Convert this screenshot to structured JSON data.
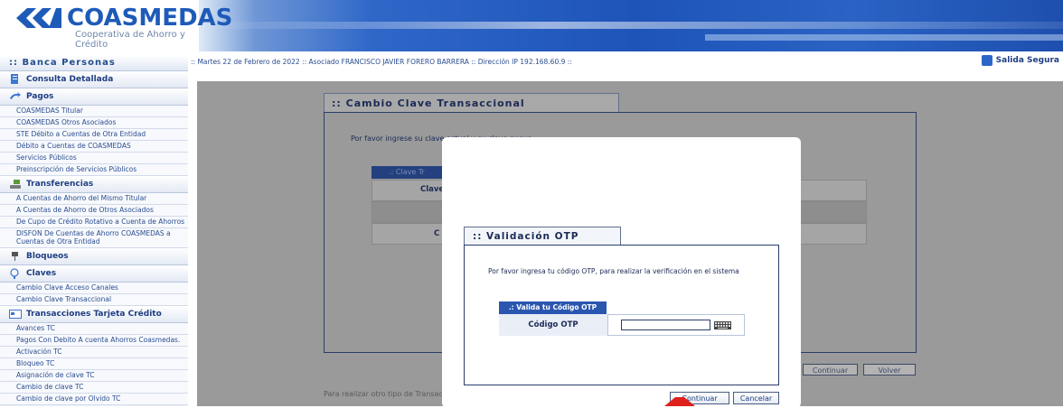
{
  "brand": {
    "name": "COASMEDAS",
    "tagline": "Cooperativa de Ahorro y Crédito",
    "primary_color": "#1e5bb8"
  },
  "sidebar": {
    "title": ":: Banca Personas",
    "sections": [
      {
        "label": "Consulta Detallada",
        "icon": "document-icon",
        "items": []
      },
      {
        "label": "Pagos",
        "icon": "transfer-arrows-icon",
        "items": [
          "COASMEDAS Titular",
          "COASMEDAS Otros Asociados",
          "STE Débito a Cuentas de Otra Entidad",
          "Débito a Cuentas de COASMEDAS",
          "Servicios Públicos",
          "Preinscripción de Servicios Públicos"
        ]
      },
      {
        "label": "Transferencias",
        "icon": "hand-money-icon",
        "items": [
          "A Cuentas de Ahorro del Mismo Titular",
          "A Cuentas de Ahorro de Otros Asociados",
          "De Cupo de Crédito Rotativo a Cuenta de Ahorros",
          "DISFON De Cuentas de Ahorro COASMEDAS a Cuentas de Otra Entidad"
        ]
      },
      {
        "label": "Bloqueos",
        "icon": "pushpin-icon",
        "items": []
      },
      {
        "label": "Claves",
        "icon": "key-icon",
        "items": [
          "Cambio Clave Acceso Canales",
          "Cambio Clave Transaccional"
        ]
      },
      {
        "label": "Transacciones Tarjeta Crédito",
        "icon": "credit-card-icon",
        "items": [
          "Avances TC",
          "Pagos Con Debito A cuenta Ahorros Coasmedas.",
          "Activación TC",
          "Bloqueo TC",
          "Asignación de clave TC",
          "Cambio de clave TC",
          "Cambio de clave por Olvido TC"
        ]
      }
    ]
  },
  "infobar": {
    "text": ":: Martes 22 de Febrero de 2022 :: Asociado FRANCISCO JAVIER FORERO BARRERA :: Dirección IP 192.168.60.9 ::"
  },
  "exit": {
    "label": "Salida Segura"
  },
  "background_form": {
    "title": ":: Cambio Clave Transaccional",
    "instruction": "Por favor ingrese su clave actual y su clave nueva",
    "table_header": ".: Clave Tr",
    "row1_label": "Clave",
    "row3_label": "C",
    "continue_label": "Continuar",
    "back_label": "Volver",
    "footnote": "Para realizar otro tipo de Transaccione"
  },
  "otp_modal": {
    "title": ":: Validación OTP",
    "instruction": "Por favor ingresa tu código OTP, para realizar la verificación en el sistema",
    "table_header": ".: Valida tu Código OTP",
    "field_label": "Código OTP",
    "field_value": "",
    "continue_label": "Continuar",
    "cancel_label": "Cancelar"
  },
  "colors": {
    "overlay_gray": "#9a9a9a",
    "table_header_blue": "#2a56b0",
    "pointer_red": "#e0201b"
  }
}
